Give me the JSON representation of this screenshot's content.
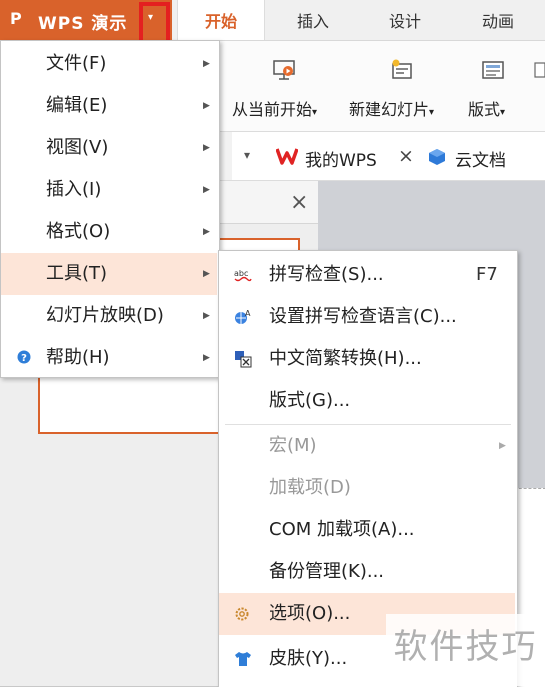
{
  "app": {
    "logo": "P",
    "title": "WPS 演示",
    "dropdown_arrow": "▾"
  },
  "tabs": [
    "开始",
    "插入",
    "设计",
    "动画"
  ],
  "ribbon": {
    "items": [
      {
        "label": "从当前开始",
        "icon": "play-from-current-icon"
      },
      {
        "label": "新建幻灯片",
        "icon": "new-slide-icon"
      },
      {
        "label": "版式",
        "icon": "layout-icon"
      }
    ],
    "caret": "▾"
  },
  "doc_tabs": {
    "dropdown": "▾",
    "my_wps": "我的WPS",
    "close": "×",
    "cloud": "云文档"
  },
  "panel": {
    "close": "×"
  },
  "main_menu": {
    "items": [
      {
        "label": "文件(F)",
        "submenu": true
      },
      {
        "label": "编辑(E)",
        "submenu": true
      },
      {
        "label": "视图(V)",
        "submenu": true
      },
      {
        "label": "插入(I)",
        "submenu": true
      },
      {
        "label": "格式(O)",
        "submenu": true
      },
      {
        "label": "工具(T)",
        "submenu": true,
        "highlighted": true
      },
      {
        "label": "幻灯片放映(D)",
        "submenu": true
      },
      {
        "label": "帮助(H)",
        "submenu": true,
        "icon": "help-icon"
      }
    ]
  },
  "tools_menu": {
    "items": [
      {
        "label": "拼写检查(S)...",
        "shortcut": "F7",
        "icon": "spellcheck-icon"
      },
      {
        "label": "设置拼写检查语言(C)...",
        "icon": "language-icon"
      },
      {
        "label": "中文简繁转换(H)...",
        "icon": "convert-icon"
      },
      {
        "label": "版式(G)..."
      },
      {
        "label": "宏(M)",
        "disabled": true,
        "submenu": true
      },
      {
        "label": "加载项(D)",
        "disabled": true
      },
      {
        "label": "COM 加载项(A)..."
      },
      {
        "label": "备份管理(K)..."
      },
      {
        "label": "选项(O)...",
        "icon": "gear-icon",
        "highlighted": true
      },
      {
        "label": "皮肤(Y)...",
        "icon": "tshirt-icon"
      }
    ]
  },
  "watermark": "软件技巧",
  "colors": {
    "accent": "#d9622b",
    "highlight": "#fde5d8",
    "red_box": "#e42020"
  }
}
